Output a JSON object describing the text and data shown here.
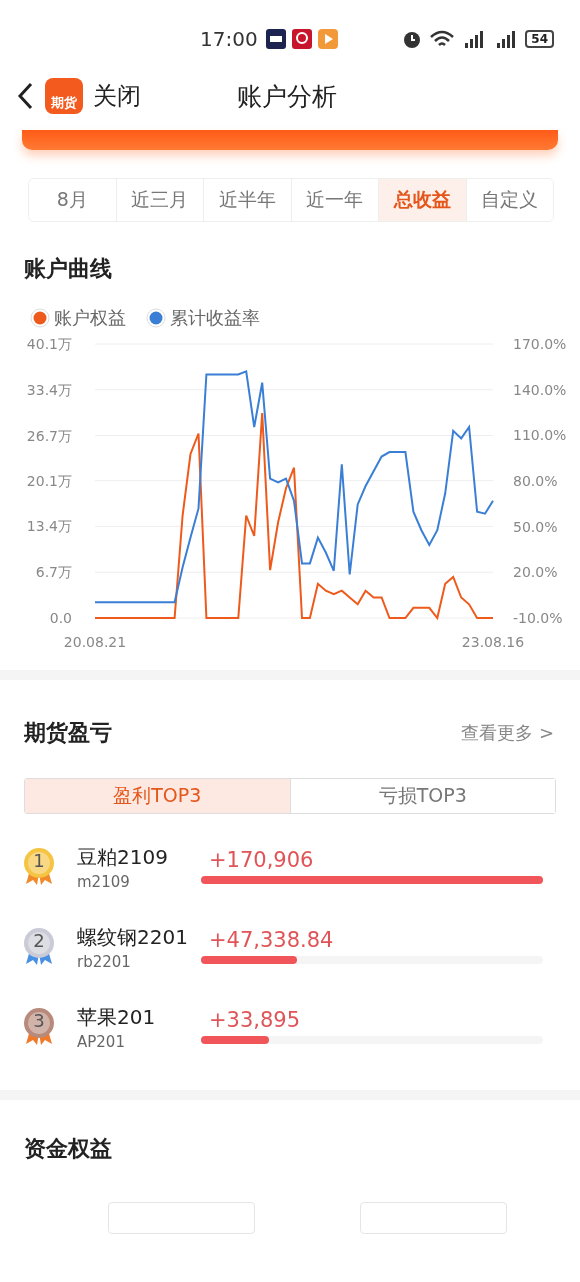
{
  "status_bar": {
    "time": "17:00",
    "battery": "54"
  },
  "header": {
    "app_icon_text": "期货",
    "close": "关闭",
    "title": "账户分析"
  },
  "periods": [
    {
      "label": "8月",
      "selected": false
    },
    {
      "label": "近三月",
      "selected": false
    },
    {
      "label": "近半年",
      "selected": false
    },
    {
      "label": "近一年",
      "selected": false
    },
    {
      "label": "总收益",
      "selected": true
    },
    {
      "label": "自定义",
      "selected": false
    }
  ],
  "curve": {
    "title": "账户曲线",
    "chart_data": {
      "type": "line",
      "categories": [
        "20.08.21",
        null,
        null,
        null,
        null,
        null,
        null,
        null,
        null,
        null,
        null,
        null,
        null,
        null,
        null,
        null,
        null,
        null,
        null,
        null,
        null,
        null,
        null,
        null,
        null,
        null,
        null,
        null,
        null,
        null,
        null,
        null,
        null,
        null,
        null,
        null,
        null,
        null,
        null,
        null,
        null,
        null,
        null,
        null,
        null,
        null,
        null,
        null,
        null,
        null,
        "23.08.16"
      ],
      "grid": true,
      "ylim": [
        0,
        40.1
      ],
      "yticks": [
        {
          "value": 0,
          "label": "0.0"
        },
        {
          "value": 6.7,
          "label": "6.7万"
        },
        {
          "value": 13.4,
          "label": "13.4万"
        },
        {
          "value": 20.1,
          "label": "20.1万"
        },
        {
          "value": 26.7,
          "label": "26.7万"
        },
        {
          "value": 33.4,
          "label": "33.4万"
        },
        {
          "value": 40.1,
          "label": "40.1万"
        }
      ],
      "y2lim": [
        -10,
        170
      ],
      "y2ticks": [
        {
          "value": -10,
          "label": "-10.0%"
        },
        {
          "value": 20,
          "label": "20.0%"
        },
        {
          "value": 50,
          "label": "50.0%"
        },
        {
          "value": 80,
          "label": "80.0%"
        },
        {
          "value": 110,
          "label": "110.0%"
        },
        {
          "value": 140,
          "label": "140.0%"
        },
        {
          "value": 170,
          "label": "170.0%"
        }
      ],
      "series": [
        {
          "name": "账户权益",
          "color": "#ee5a1c",
          "axis": "y",
          "values": [
            0,
            0,
            0,
            0,
            0,
            0,
            0,
            0,
            0,
            0,
            0,
            15,
            24,
            27,
            0,
            0,
            0,
            0,
            0,
            15,
            12,
            30,
            7,
            14,
            19,
            22,
            0,
            0,
            5,
            4,
            3.5,
            4,
            3,
            2,
            4,
            3,
            3,
            0,
            0,
            0,
            1.5,
            1.5,
            1.5,
            0,
            5,
            6,
            3,
            2,
            0,
            0,
            0
          ]
        },
        {
          "name": "累计收益率",
          "color": "#3a7fd5",
          "axis": "y2",
          "values": [
            0.4,
            0.4,
            0.4,
            0.4,
            0.4,
            0.4,
            0.4,
            0.4,
            0.4,
            0.4,
            0.4,
            23.4,
            42.8,
            62,
            150,
            150,
            150,
            150,
            150,
            152,
            115.5,
            144.6,
            81.6,
            79,
            81.6,
            67,
            25.9,
            25.9,
            42.8,
            33,
            21,
            91,
            18.6,
            64.6,
            76.7,
            86.4,
            96,
            99,
            99,
            99,
            59.8,
            47.7,
            38,
            47.7,
            71.9,
            113,
            108,
            115.5,
            59.8,
            58.5,
            67
          ]
        }
      ]
    }
  },
  "pnl": {
    "title": "期货盈亏",
    "more": "查看更多 >",
    "tabs": [
      {
        "label": "盈利TOP3",
        "selected": true
      },
      {
        "label": "亏损TOP3",
        "selected": false
      }
    ],
    "rows": [
      {
        "rank": "1",
        "kind": "gold",
        "name": "豆粕2109",
        "code": "m2109",
        "value": "+170,906",
        "level": 1
      },
      {
        "rank": "2",
        "kind": "silver",
        "name": "螺纹钢2201",
        "code": "rb2201",
        "value": "+47,338.84",
        "level": 0.28
      },
      {
        "rank": "3",
        "kind": "bronze",
        "name": "苹果201",
        "code": "AP201",
        "value": "+33,895",
        "level": 0.2
      }
    ]
  },
  "equity": {
    "title": "资金权益"
  }
}
